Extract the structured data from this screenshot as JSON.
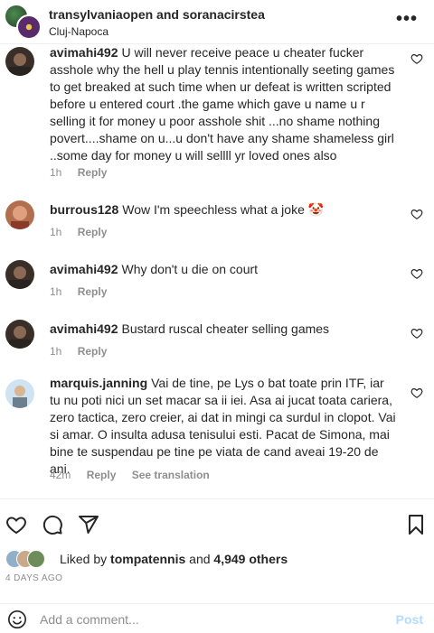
{
  "header": {
    "title": "transylvaniaopen and soranacirstea",
    "location": "Cluj-Napoca",
    "more_icon": "more-horizontal-icon"
  },
  "comments": [
    {
      "username": "avimahi492",
      "text": "U will never receive peace u cheater fucker asshole why the hell u play tennis intentionally seeting games to get breaked at such time when ur defeat is written scripted before u entered court .the game which gave u name u r selling it for money u poor asshole shit ...no shame nothing povert....shame on u...u don't have any shame shameless girl ..some day for money u will sellll yr loved ones also",
      "time": "1h",
      "reply": "Reply"
    },
    {
      "username": "burrous128",
      "text": "Wow I'm speechless what a joke 🤡",
      "time": "1h",
      "reply": "Reply"
    },
    {
      "username": "avimahi492",
      "text": "Why don't u die on court",
      "time": "1h",
      "reply": "Reply"
    },
    {
      "username": "avimahi492",
      "text": "Bustard ruscal cheater selling games",
      "time": "1h",
      "reply": "Reply"
    },
    {
      "username": "marquis.janning",
      "text": "Vai de tine, pe Lys o bat toate prin ITF, iar tu nu poti nici un set macar sa ii iei. Asa ai jucat toata cariera, zero tactica, zero creier, ai dat in mingi ca surdul in clopot. Vai si amar. O insulta adusa tenisului esti. Pacat de Simona, mai bine te suspendau pe tine pe viata de cand aveai 19-20 de ani.",
      "time": "42m",
      "reply": "Reply",
      "translate": "See translation"
    }
  ],
  "actions": {
    "like_icon": "heart-icon",
    "comment_icon": "comment-icon",
    "share_icon": "share-icon",
    "save_icon": "bookmark-icon"
  },
  "likes": {
    "prefix": "Liked by ",
    "user": "tompatennis",
    "middle": " and ",
    "count": "4,949 others"
  },
  "posted": "4 DAYS AGO",
  "add_comment": {
    "placeholder": "Add a comment...",
    "post_label": "Post"
  }
}
